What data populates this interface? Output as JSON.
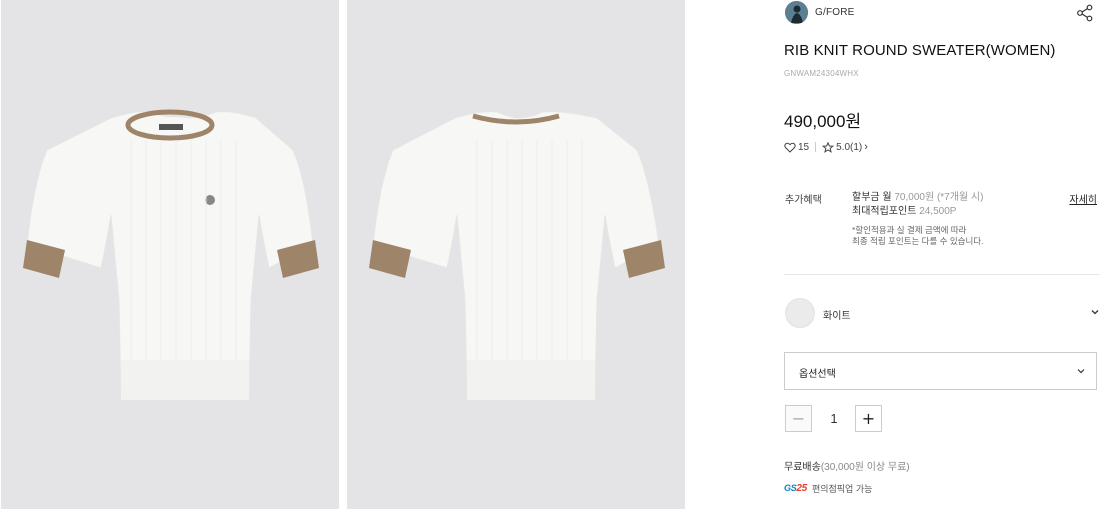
{
  "brand": {
    "name": "G/FORE",
    "logo_icon": "brand-avatar-icon"
  },
  "share_icon": "share-icon",
  "product": {
    "title": "RIB KNIT ROUND SWEATER(WOMEN)",
    "code": "GNWAM24304WHX",
    "price": "490,000원"
  },
  "stats": {
    "likes": "15",
    "rating": "5.0(1)",
    "rating_arrow": "›"
  },
  "benefit": {
    "label": "추가혜택",
    "installment_label": "할부금 월",
    "installment_value": "70,000원 (*7개월 시)",
    "points_label": "최대적립포인트",
    "points_value": "24,500P",
    "note_line1": "*할인적용과 실 결제 금액에 따라",
    "note_line2": "최종 적립 포인트는 다를 수 있습니다.",
    "detail_link": "자세히"
  },
  "color": {
    "label": "화이트",
    "swatch": "#ebebec"
  },
  "option": {
    "label": "옵션선택"
  },
  "quantity": {
    "minus": "−",
    "value": "1",
    "plus": "+"
  },
  "shipping": {
    "label": "무료배송",
    "condition": "(30,000원 이상 무료)"
  },
  "pickup": {
    "logo_text": "GS",
    "logo_num": "25",
    "text": "편의점픽업 가능"
  },
  "colors": {
    "gallery_bg": "#e4e4e6",
    "sweater": "#f8f8f6",
    "trim": "#9e8468"
  }
}
